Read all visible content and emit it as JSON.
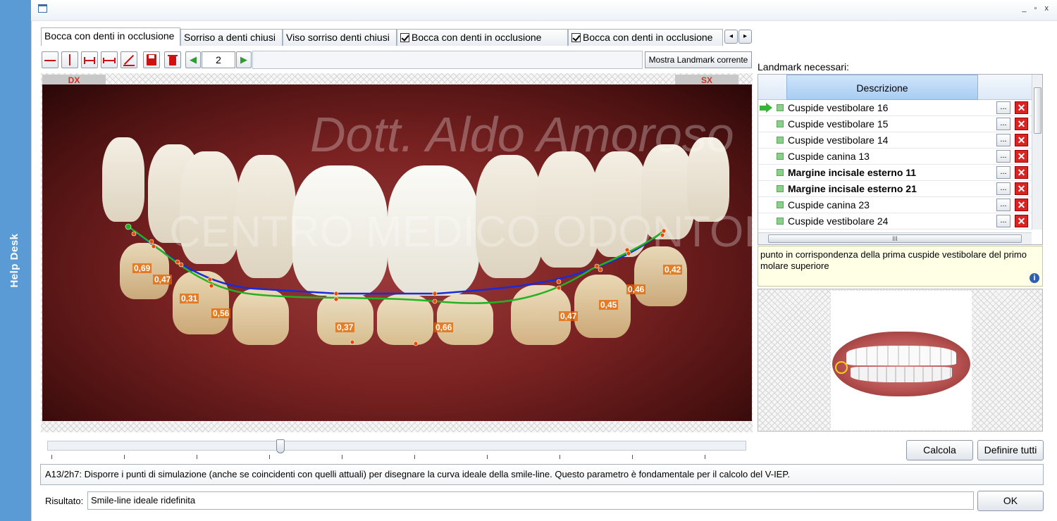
{
  "sidebar": {
    "label": "Help Desk"
  },
  "window": {
    "controls": "_ ▫ x"
  },
  "tabs": [
    {
      "label": "Bocca con denti in occlusione",
      "checked": false,
      "active": true
    },
    {
      "label": "Sorriso a denti chiusi",
      "checked": false,
      "active": false
    },
    {
      "label": "Viso sorriso denti chiusi",
      "checked": false,
      "active": false
    },
    {
      "label": "Bocca con denti in occlusione",
      "checked": true,
      "active": false
    },
    {
      "label": "Bocca con denti in occlusione",
      "checked": true,
      "active": false
    }
  ],
  "tab_scroll": {
    "left": "◂",
    "right": "▸"
  },
  "toolbar": {
    "page_value": "2",
    "prev_icon": "◀",
    "next_icon": "▶",
    "mostra_label": "Mostra Landmark corrente"
  },
  "photo": {
    "dx_label": "DX",
    "sx_label": "SX",
    "watermark_1": "Dott. Aldo Amoroso",
    "watermark_2": "CENTRO MEDICO ODONTOIATRICO",
    "measurements": [
      "0,69",
      "0,47",
      "0,31",
      "0,56",
      "0,37",
      "0,66",
      "0,47",
      "0,45",
      "0,46",
      "0,42"
    ],
    "colors": {
      "current_line": "#1a2bd8",
      "ideal_line": "#22b322",
      "point": "#e84a00"
    }
  },
  "landmarks": {
    "title": "Landmark necessari:",
    "header": "Descrizione",
    "rows": [
      {
        "label": "Cuspide vestibolare 16",
        "bold": false,
        "current": true
      },
      {
        "label": "Cuspide vestibolare 15",
        "bold": false,
        "current": false
      },
      {
        "label": "Cuspide vestibolare 14",
        "bold": false,
        "current": false
      },
      {
        "label": "Cuspide canina 13",
        "bold": false,
        "current": false
      },
      {
        "label": "Margine incisale esterno 11",
        "bold": true,
        "current": false
      },
      {
        "label": "Margine incisale esterno 21",
        "bold": true,
        "current": false
      },
      {
        "label": "Cuspide canina 23",
        "bold": false,
        "current": false
      },
      {
        "label": "Cuspide vestibolare 24",
        "bold": false,
        "current": false
      }
    ],
    "dots_label": "...",
    "delete_label": "✕",
    "hscroll_label": "III",
    "description": "punto in corrispondenza della prima cuspide vestibolare del primo molare superiore",
    "info_icon": "i"
  },
  "buttons": {
    "calcola": "Calcola",
    "definire": "Definire tutti",
    "ok": "OK"
  },
  "instruction": "A13/2h7: Disporre i punti di simulazione (anche se coincidenti con quelli attuali) per disegnare la curva ideale della smile-line. Questo parametro è fondamentale per il calcolo del V-IEP.",
  "risultato": {
    "label": "Risultato:",
    "value": "Smile-line ideale ridefinita"
  }
}
